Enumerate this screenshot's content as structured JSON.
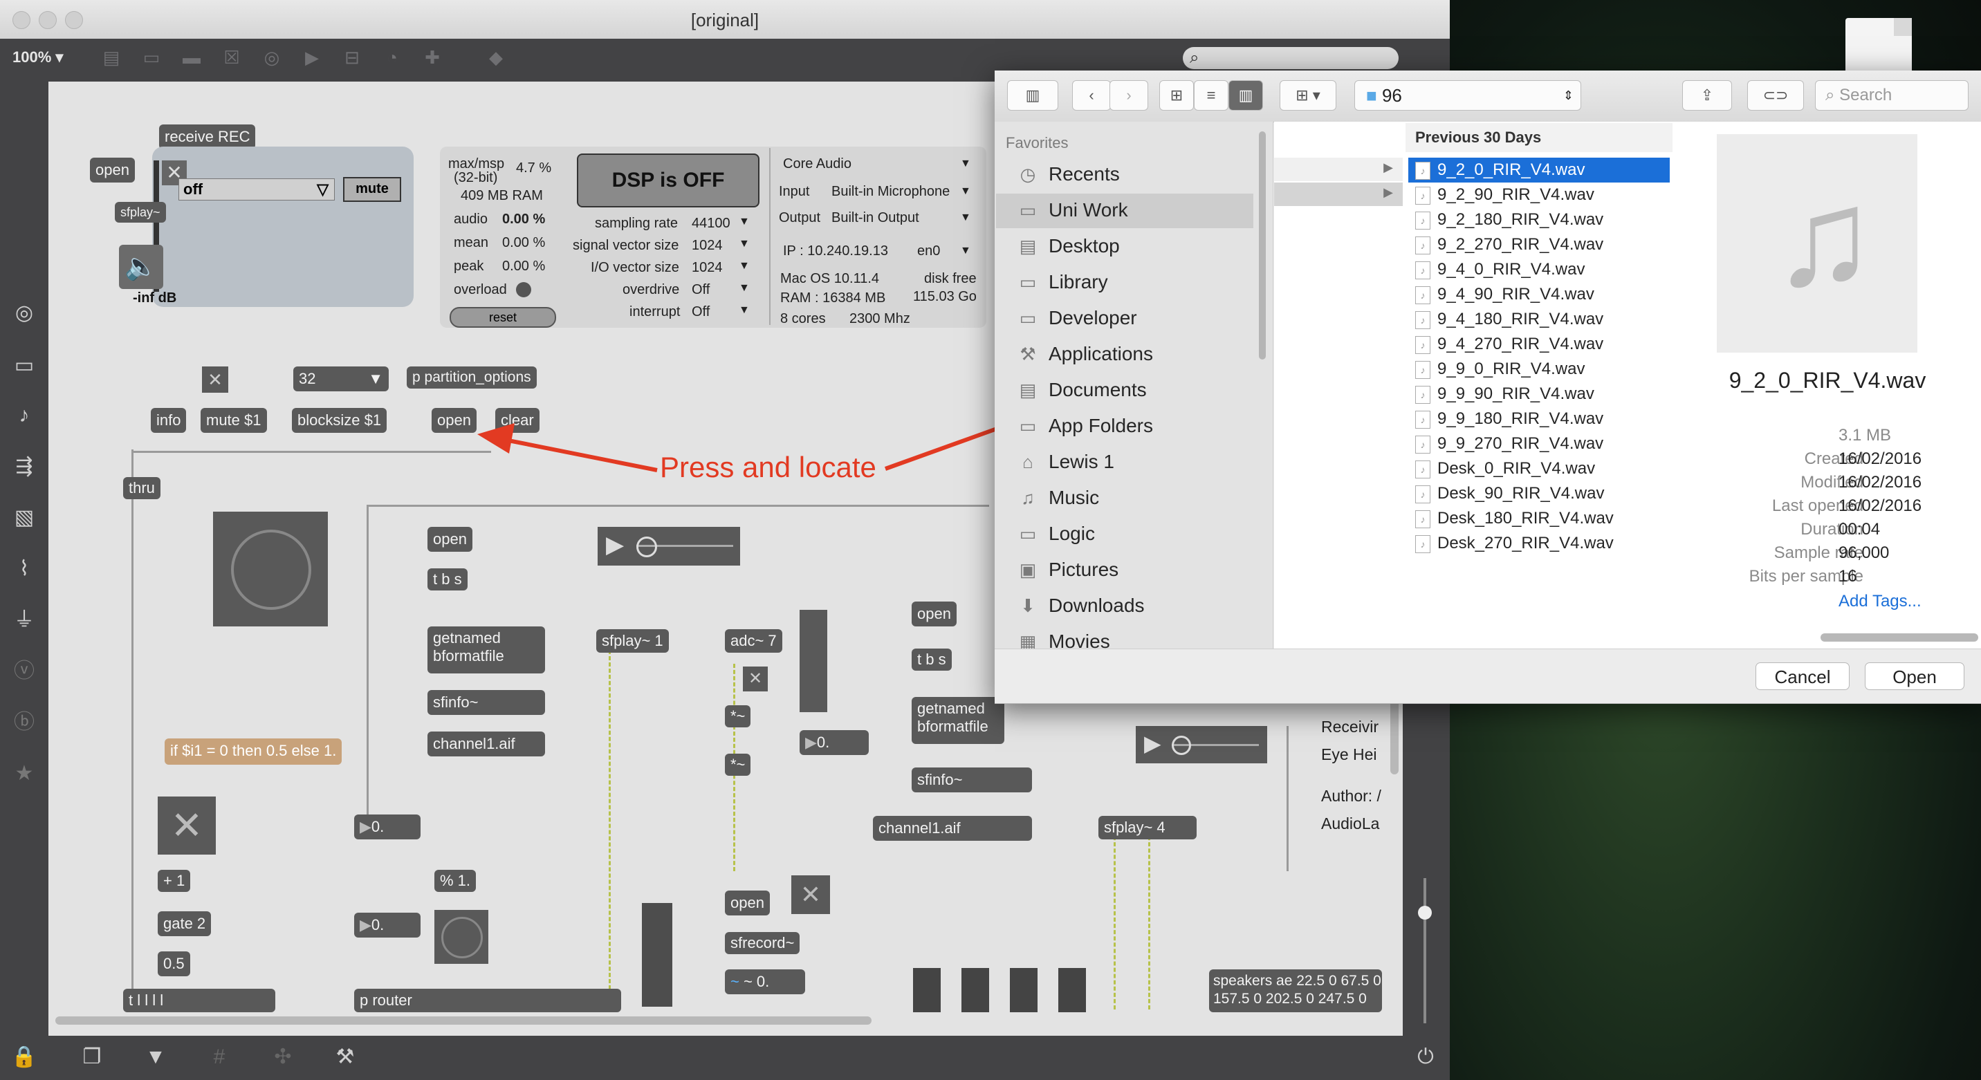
{
  "window": {
    "title": "[original]",
    "zoom": "100%"
  },
  "patch": {
    "receive": "receive REC",
    "open_left": "open",
    "menu_off": "off",
    "mute_btn": "mute",
    "sfplay_small": "sfplay~",
    "level": "-inf dB",
    "info": "info",
    "mute1": "mute $1",
    "blocksize_num": "32",
    "blocksize": "blocksize $1",
    "partition": "p partition_options",
    "open_top": "open",
    "clear": "clear",
    "thru": "thru",
    "annotation": "Press and locate",
    "open2": "open",
    "tbs1": "t b s",
    "getnamed1": "getnamed",
    "bformat1": "bformatfile",
    "sfinfo1": "sfinfo~",
    "channel1": "channel1.aif",
    "sfplay1": "sfplay~ 1",
    "adc": "adc~ 7",
    "mul1": "*~",
    "mul2": "*~",
    "num0a": "0.",
    "open3": "open",
    "tbs2": "t b s",
    "getnamed2": "getnamed",
    "bformat2": "bformatfile",
    "sfinfo2": "sfinfo~",
    "channel2": "channel1.aif",
    "sfplay4": "sfplay~ 4",
    "expr": "if $i1 = 0 then 0.5 else 1.",
    "num0b": "0.",
    "plus1": "+ 1",
    "gate": "gate 2",
    "half": "0.5",
    "num0c": "0.",
    "mod1": "% 1.",
    "trig": "t l l l l",
    "router": "p router",
    "open4": "open",
    "sfrecord": "sfrecord~",
    "sig": "~ 0.",
    "recv": "Receivir",
    "eye": "Eye Hei",
    "author": "Author: /",
    "audiola": "AudioLa",
    "speakers1": "speakers ae 22.5 0 67.5 0",
    "speakers2": "157.5 0 202.5 0 247.5 0"
  },
  "dsp": {
    "app": "max/msp",
    "bits": "(32-bit)",
    "cpu": "4.7 %",
    "ram": "409 MB RAM",
    "audio_l": "audio",
    "audio_v": "0.00 %",
    "mean_l": "mean",
    "mean_v": "0.00 %",
    "peak_l": "peak",
    "peak_v": "0.00 %",
    "overload": "overload",
    "reset": "reset",
    "button": "DSP is OFF",
    "sr_l": "sampling rate",
    "sr_v": "44100",
    "svs_l": "signal vector size",
    "svs_v": "1024",
    "io_l": "I/O vector size",
    "io_v": "1024",
    "od_l": "overdrive",
    "od_v": "Off",
    "int_l": "interrupt",
    "int_v": "Off",
    "driver": "Core Audio",
    "input_l": "Input",
    "input_v": "Built-in Microphone",
    "output_l": "Output",
    "output_v": "Built-in Output",
    "ip": "IP : 10.240.19.13",
    "iface": "en0",
    "os": "Mac OS 10.11.4",
    "disk_l": "disk free",
    "ram2": "RAM : 16384 MB",
    "disk_v": "115.03 Go",
    "cores": "8 cores",
    "mhz": "2300 Mhz"
  },
  "dialog": {
    "folder": "96",
    "search_placeholder": "Search",
    "favorites_label": "Favorites",
    "sidebar": [
      {
        "label": "Recents",
        "icon": "clock-icon"
      },
      {
        "label": "Uni Work",
        "icon": "folder-icon"
      },
      {
        "label": "Desktop",
        "icon": "desktop-icon"
      },
      {
        "label": "Library",
        "icon": "folder-icon"
      },
      {
        "label": "Developer",
        "icon": "folder-icon"
      },
      {
        "label": "Applications",
        "icon": "applications-icon"
      },
      {
        "label": "Documents",
        "icon": "documents-icon"
      },
      {
        "label": "App Folders",
        "icon": "folder-icon"
      },
      {
        "label": "Lewis 1",
        "icon": "home-icon"
      },
      {
        "label": "Music",
        "icon": "music-icon"
      },
      {
        "label": "Logic",
        "icon": "folder-icon"
      },
      {
        "label": "Pictures",
        "icon": "camera-icon"
      },
      {
        "label": "Downloads",
        "icon": "download-icon"
      },
      {
        "label": "Movies",
        "icon": "film-icon"
      }
    ],
    "section": "Previous 30 Days",
    "files": [
      "9_2_0_RIR_V4.wav",
      "9_2_90_RIR_V4.wav",
      "9_2_180_RIR_V4.wav",
      "9_2_270_RIR_V4.wav",
      "9_4_0_RIR_V4.wav",
      "9_4_90_RIR_V4.wav",
      "9_4_180_RIR_V4.wav",
      "9_4_270_RIR_V4.wav",
      "9_9_0_RIR_V4.wav",
      "9_9_90_RIR_V4.wav",
      "9_9_180_RIR_V4.wav",
      "9_9_270_RIR_V4.wav",
      "Desk_0_RIR_V4.wav",
      "Desk_90_RIR_V4.wav",
      "Desk_180_RIR_V4.wav",
      "Desk_270_RIR_V4.wav"
    ],
    "preview": {
      "name": "9_2_0_RIR_V4.wav",
      "size": "3.1 MB",
      "fields": [
        {
          "k": "Created",
          "v": "16/02/2016"
        },
        {
          "k": "Modified",
          "v": "16/02/2016"
        },
        {
          "k": "Last opened",
          "v": "16/02/2016"
        },
        {
          "k": "Duration",
          "v": "00:04"
        },
        {
          "k": "Sample rate",
          "v": "96,000"
        },
        {
          "k": "Bits per sample",
          "v": "16"
        }
      ],
      "add_tags": "Add Tags..."
    },
    "cancel": "Cancel",
    "open": "Open"
  },
  "colors": {
    "accent": "#1b6fd8",
    "annotation": "#e23a22",
    "canvas": "#e3e3e3"
  }
}
